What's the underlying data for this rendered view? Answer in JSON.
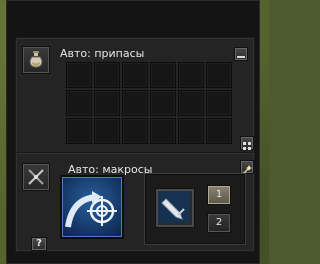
{
  "supplies": {
    "title": "Авто: припасы",
    "slot_rows": 3,
    "slot_cols": 6
  },
  "macros": {
    "title": "Авто: макросы",
    "pages": [
      "1",
      "2"
    ],
    "active_page": "1"
  },
  "help_label": "?",
  "icons": {
    "supplies": "potion-icon",
    "macros": "crossed-swords-icon",
    "minimize": "minus-icon",
    "grid_toggle": "grid-dots-icon",
    "wand": "magic-wand-icon",
    "macro_skill": "target-arrow-icon",
    "slot_skill": "sword-icon"
  }
}
